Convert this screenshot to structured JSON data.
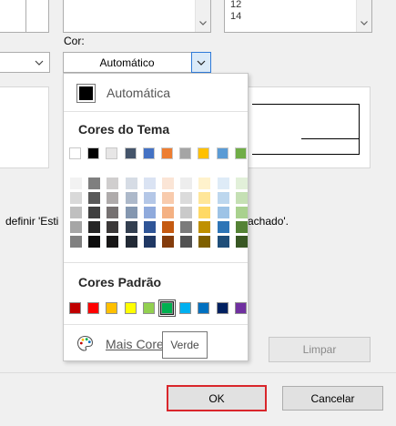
{
  "top_list_right": {
    "items": [
      "12",
      "14"
    ]
  },
  "color_label": "Cor:",
  "color_combo": {
    "value": "Automático"
  },
  "info_text_left": "definir 'Esti",
  "info_text_right": "achado'.",
  "palette": {
    "automatic_label": "Automática",
    "theme_title": "Cores do Tema",
    "standard_title": "Cores Padrão",
    "more_colors_label": "Mais Cores...",
    "theme_colors": [
      "#ffffff",
      "#000000",
      "#e7e6e6",
      "#44546a",
      "#4472c4",
      "#ed7d31",
      "#a5a5a5",
      "#ffc000",
      "#5b9bd5",
      "#70ad47"
    ],
    "theme_tints": [
      [
        "#f2f2f2",
        "#d9d9d9",
        "#bfbfbf",
        "#a6a6a6",
        "#808080"
      ],
      [
        "#7f7f7f",
        "#595959",
        "#404040",
        "#262626",
        "#0d0d0d"
      ],
      [
        "#d0cece",
        "#afabab",
        "#767171",
        "#3b3838",
        "#171616"
      ],
      [
        "#d6dce5",
        "#adb9ca",
        "#8497b0",
        "#333f50",
        "#222a35"
      ],
      [
        "#dae3f3",
        "#b4c7e7",
        "#8faadc",
        "#2f5597",
        "#203864"
      ],
      [
        "#fbe5d6",
        "#f8cbad",
        "#f4b183",
        "#c55a11",
        "#843c0c"
      ],
      [
        "#ededed",
        "#dbdbdb",
        "#c9c9c9",
        "#7b7b7b",
        "#525252"
      ],
      [
        "#fff2cc",
        "#ffe699",
        "#ffd966",
        "#bf9000",
        "#7f6000"
      ],
      [
        "#deebf7",
        "#bdd7ee",
        "#9dc3e6",
        "#2e75b6",
        "#1f4e79"
      ],
      [
        "#e2f0d9",
        "#c5e0b4",
        "#a9d18e",
        "#548235",
        "#385723"
      ]
    ],
    "standard_colors": [
      "#c00000",
      "#ff0000",
      "#ffc000",
      "#ffff00",
      "#92d050",
      "#00b050",
      "#00b0f0",
      "#0070c0",
      "#002060",
      "#7030a0"
    ],
    "selected_standard_index": 5
  },
  "tooltip": "Verde",
  "buttons": {
    "clear": "Limpar",
    "ok": "OK",
    "cancel": "Cancelar"
  },
  "colors": {
    "ok_highlight": "#d9262b"
  }
}
